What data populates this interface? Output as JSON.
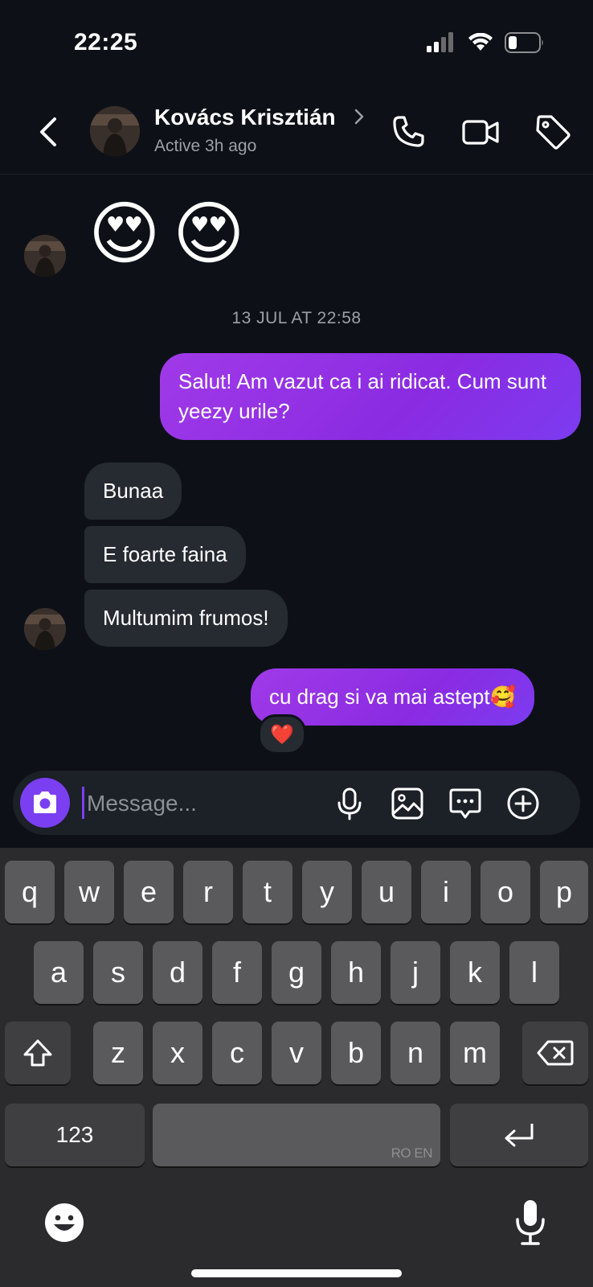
{
  "status_bar": {
    "time": "22:25",
    "icons": [
      "signal-icon",
      "wifi-icon",
      "battery-icon"
    ]
  },
  "header": {
    "name": "Kovács Krisztián",
    "status": "Active 3h ago",
    "icons": [
      "back-icon",
      "phone-icon",
      "video-icon",
      "tag-icon"
    ]
  },
  "messages": {
    "emoji_reply": [
      "😍",
      "😍"
    ],
    "timestamp": "13 JUL AT 22:58",
    "outgoing_1": "Salut! Am vazut ca i ai ridicat. Cum sunt yeezy urile?",
    "incoming": [
      "Bunaa",
      "E foarte faina",
      "Multumim frumos!"
    ],
    "outgoing_2": "cu drag si va mai astept🥰",
    "reaction": "❤️"
  },
  "composer": {
    "placeholder": "Message...",
    "icons": [
      "camera-icon",
      "microphone-icon",
      "gallery-icon",
      "sticker-icon",
      "plus-icon"
    ]
  },
  "keyboard": {
    "row1": [
      "q",
      "w",
      "e",
      "r",
      "t",
      "y",
      "u",
      "i",
      "o",
      "p"
    ],
    "row2": [
      "a",
      "s",
      "d",
      "f",
      "g",
      "h",
      "j",
      "k",
      "l"
    ],
    "row3": [
      "z",
      "x",
      "c",
      "v",
      "b",
      "n",
      "m"
    ],
    "numbers_label": "123",
    "space_lang": "RO EN",
    "icons": [
      "shift-icon",
      "backspace-icon",
      "return-icon",
      "emoji-icon",
      "dictation-icon"
    ]
  },
  "colors": {
    "background": "#0d1117",
    "outgoing_bubble": "#8a2be2",
    "incoming_bubble": "#262a31",
    "accent": "#7b3ff2"
  }
}
